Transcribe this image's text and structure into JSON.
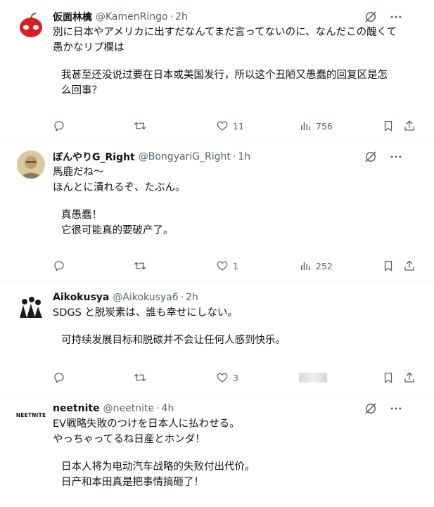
{
  "colors": {
    "text": "#0f1419",
    "secondary": "#536471",
    "divider": "#eff3f4"
  },
  "tweets": [
    {
      "name": "仮面林檎",
      "handle": "@KamenRingo",
      "time": "2h",
      "lines": [
        "別に日本やアメリカに出すだなんてまだ言ってないのに、なんだこの醜くて",
        "愚かなリプ欄は"
      ],
      "translation": [
        "我甚至还没说过要在日本或美国发行，所以这个丑陋又愚蠢的回复区是怎",
        "么回事？"
      ],
      "replies": "",
      "reposts": "",
      "likes": "11",
      "views": "756",
      "avatar_icon": "apple-avatar"
    },
    {
      "name": "ぼんやりG_Right",
      "handle": "@BongyariG_Right",
      "time": "1h",
      "lines": [
        "馬鹿だね～",
        "ほんとに潰れるぞ、たぶん。"
      ],
      "translation": [
        "真愚蠢！",
        "它很可能真的要破产了。"
      ],
      "replies": "",
      "reposts": "",
      "likes": "1",
      "views": "252",
      "avatar_icon": "portrait-avatar"
    },
    {
      "name": "Aikokusya",
      "handle": "@Aikokusya6",
      "time": "2h",
      "lines": [
        "SDGS と脱炭素は、誰も幸せにしない。"
      ],
      "translation": [
        "可持续发展目标和脱碳并不会让任何人感到快乐。"
      ],
      "replies": "",
      "reposts": "",
      "likes": "3",
      "views": "",
      "avatar_icon": "group-avatar"
    },
    {
      "name": "neetnite",
      "handle": "@neetnite",
      "time": "4h",
      "lines": [
        "EV戦略失敗のつけを日本人に払わせる。",
        "やっちゃってるね日産とホンダ！"
      ],
      "translation": [
        "日本人将为电动汽车战略的失败付出代价。",
        "日产和本田真是把事情搞砸了！"
      ],
      "avatar_text": "NEETNITE",
      "avatar_icon": "text-logo-avatar"
    }
  ],
  "icons": {
    "grok": "grok-icon",
    "more": "more-icon",
    "reply": "reply-icon",
    "repost": "repost-icon",
    "like": "like-icon",
    "views": "views-icon",
    "bookmark": "bookmark-icon",
    "share": "share-icon"
  }
}
